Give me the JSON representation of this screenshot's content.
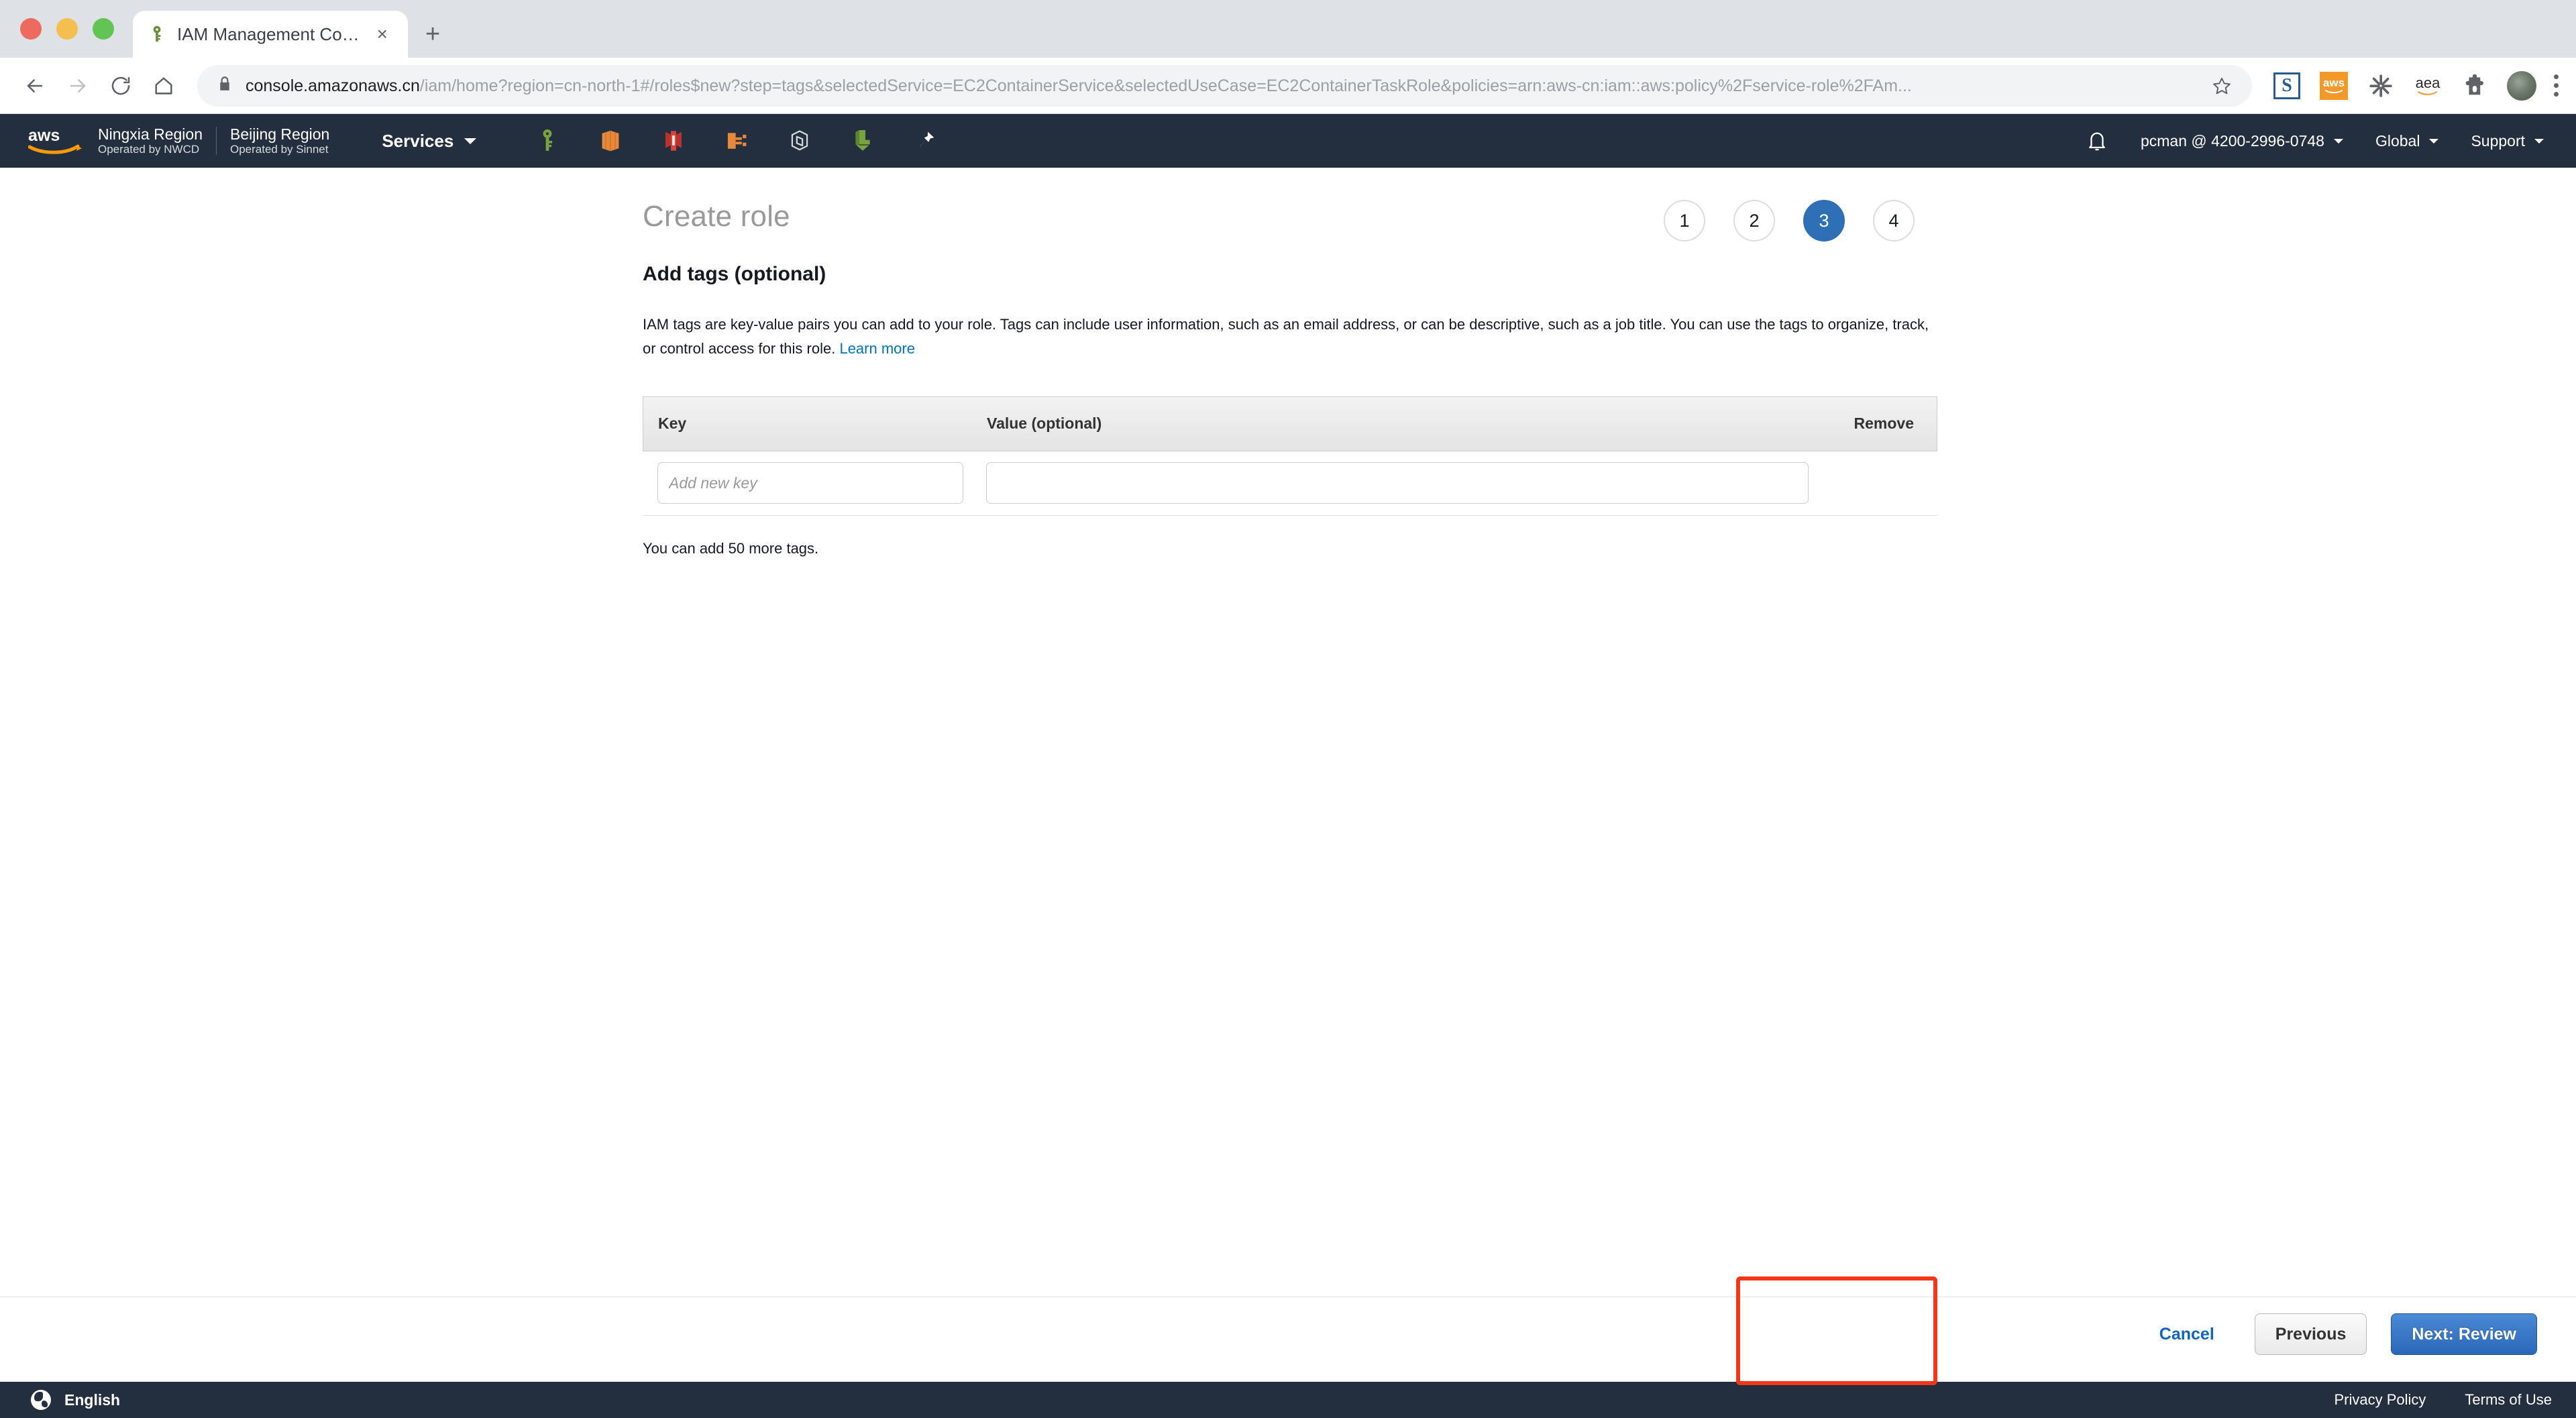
{
  "browser": {
    "tab": {
      "title": "IAM Management Console",
      "favicon": "iam-key-icon",
      "close": "×"
    },
    "new_tab_label": "+",
    "nav": {
      "back": "back-arrow-icon",
      "forward": "forward-arrow-icon",
      "reload": "reload-icon",
      "home": "home-icon"
    },
    "omnibox": {
      "lock": "lock-icon",
      "host": "console.amazonaws.cn",
      "path": "/iam/home?region=cn-north-1#/roles$new?step=tags&selectedService=EC2ContainerService&selectedUseCase=EC2ContainerTaskRole&policies=arn:aws-cn:iam::aws:policy%2Fservice-role%2FAm...",
      "star": "star-icon"
    },
    "extensions": [
      {
        "name": "screenshot-extension-icon",
        "label": "S"
      },
      {
        "name": "aws-extension-icon",
        "label": "aws"
      },
      {
        "name": "asterisk-extension-icon",
        "label": ""
      },
      {
        "name": "aea-extension-icon",
        "label": "aea"
      },
      {
        "name": "puzzle-extensions-icon",
        "label": ""
      }
    ],
    "profile_avatar": "profile-avatar",
    "menu": "kebab-menu-icon"
  },
  "aws_nav": {
    "logo": "aws-logo",
    "regions": [
      {
        "name": "Ningxia Region",
        "operator": "Operated by NWCD"
      },
      {
        "name": "Beijing Region",
        "operator": "Operated by Sinnet"
      }
    ],
    "services_label": "Services",
    "pinned_icons": [
      "iam-service-icon",
      "compute-service-icon",
      "database-service-icon",
      "gateway-service-icon",
      "container-service-icon",
      "storage-service-icon",
      "pin-icon"
    ],
    "bell": "notifications-bell-icon",
    "account_label": "pcman @ 4200-2996-0748",
    "region_label": "Global",
    "support_label": "Support"
  },
  "main": {
    "title": "Create role",
    "subtitle": "Add tags (optional)",
    "description_part1": "IAM tags are key-value pairs you can add to your role. Tags can include user information, such as an email address, or can be descriptive, such as a job title. You can use the tags to organize, track, or control access for this role. ",
    "learn_more_label": "Learn more",
    "steps": [
      {
        "label": "1",
        "active": false
      },
      {
        "label": "2",
        "active": false
      },
      {
        "label": "3",
        "active": true
      },
      {
        "label": "4",
        "active": false
      }
    ],
    "table": {
      "headers": {
        "key": "Key",
        "value": "Value (optional)",
        "remove": "Remove"
      },
      "rows": [
        {
          "key_value": "",
          "key_placeholder": "Add new key",
          "value_value": "",
          "value_placeholder": ""
        }
      ]
    },
    "tags_note": "You can add 50 more tags."
  },
  "actions": {
    "cancel_label": "Cancel",
    "previous_label": "Previous",
    "next_label": "Next: Review",
    "highlight_color": "#f4361a",
    "primary_color": "#2b67b8"
  },
  "footer": {
    "language": "English",
    "globe_icon": "globe-icon",
    "links": [
      "Privacy Policy",
      "Terms of Use"
    ]
  }
}
